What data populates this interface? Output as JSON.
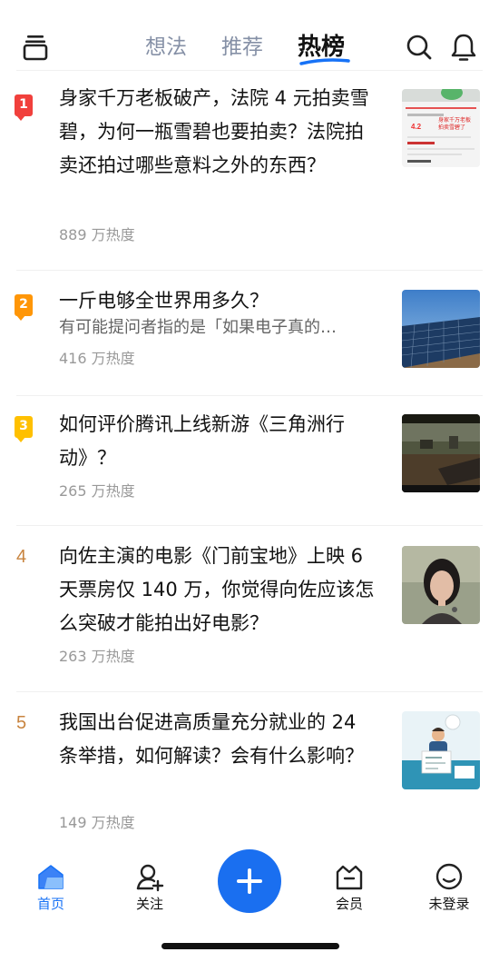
{
  "tabs": [
    {
      "label": "想法",
      "active": false
    },
    {
      "label": "推荐",
      "active": false
    },
    {
      "label": "热榜",
      "active": true
    }
  ],
  "icons": {
    "menu": "menu-icon",
    "search": "search-icon",
    "notifications": "bell-icon"
  },
  "colors": {
    "accent": "#1772f6",
    "rank1": "#f1403c",
    "rank2": "#ff9607",
    "rank3": "#ffc000",
    "rank_plain": "#c8843f"
  },
  "hot_list": [
    {
      "rank": "1",
      "title": "身家千万老板破产，法院 4 元拍卖雪碧，为何一瓶雪碧也要拍卖？法院拍卖还拍过哪些意料之外的东西？",
      "excerpt": "",
      "heat": "889 万热度"
    },
    {
      "rank": "2",
      "title": "一斤电够全世界用多久？",
      "excerpt": "有可能提问者指的是「如果电子真的…",
      "heat": "416 万热度"
    },
    {
      "rank": "3",
      "title": "如何评价腾讯上线新游《三角洲行动》？",
      "excerpt": "",
      "heat": "265 万热度"
    },
    {
      "rank": "4",
      "title": "向佐主演的电影《门前宝地》上映 6 天票房仅 140 万，你觉得向佐应该怎么突破才能拍出好电影？",
      "excerpt": "",
      "heat": "263 万热度"
    },
    {
      "rank": "5",
      "title": "我国出台促进高质量充分就业的 24 条举措，如何解读？会有什么影响？",
      "excerpt": "",
      "heat": "149 万热度"
    }
  ],
  "thumb1_text": {
    "line1": "身家千万老板",
    "line2": "拍卖雪碧了",
    "price": "4.2"
  },
  "bottom_nav": [
    {
      "label": "首页",
      "icon": "home-icon",
      "active": true
    },
    {
      "label": "关注",
      "icon": "follow-icon",
      "active": false
    },
    {
      "label": "",
      "icon": "plus-icon",
      "active": false
    },
    {
      "label": "会员",
      "icon": "vip-icon",
      "active": false
    },
    {
      "label": "未登录",
      "icon": "profile-icon",
      "active": false
    }
  ]
}
